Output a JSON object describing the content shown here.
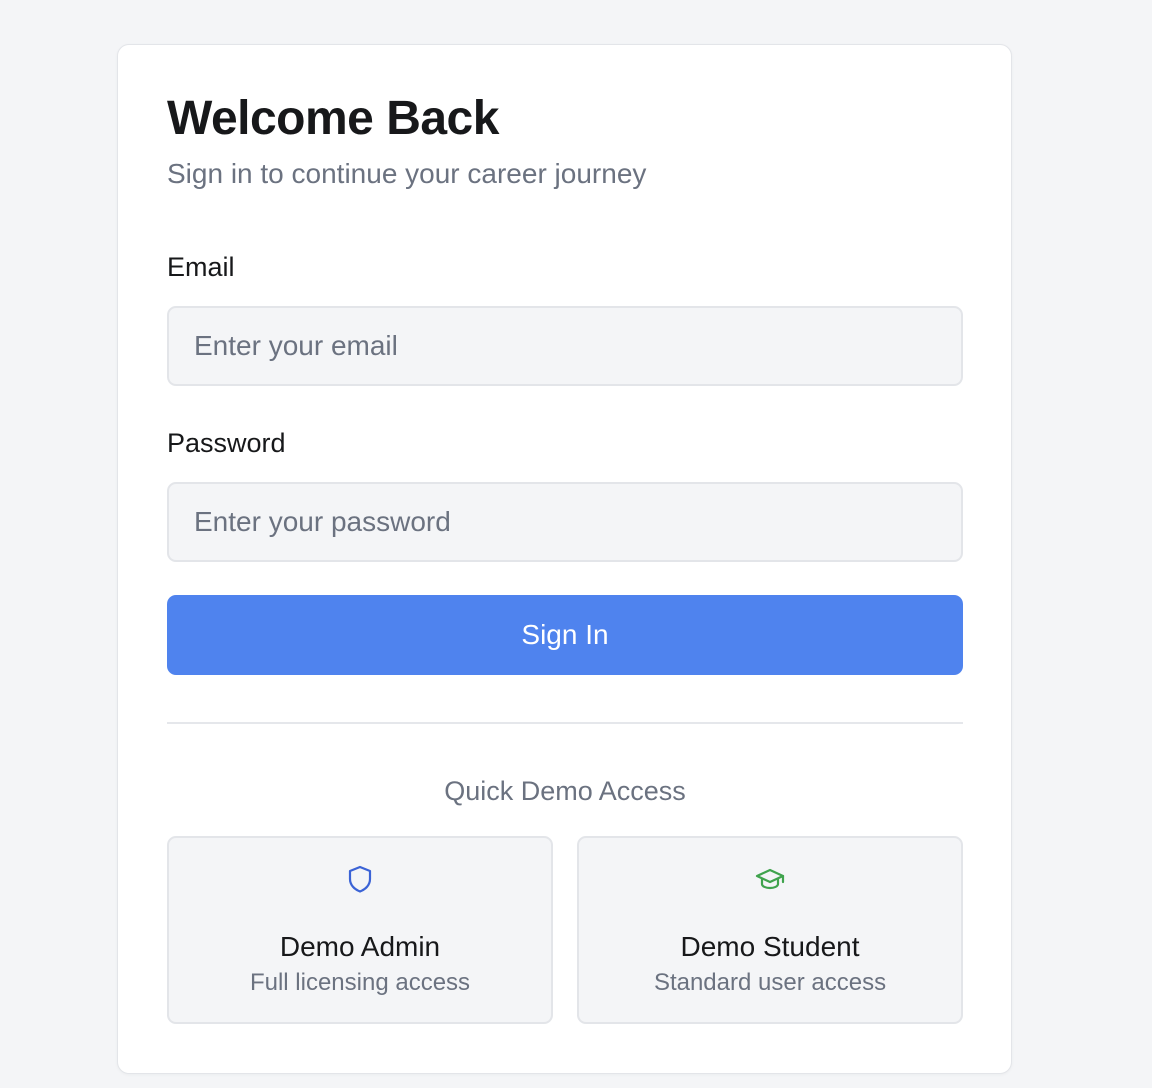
{
  "header": {
    "title": "Welcome Back",
    "subtitle": "Sign in to continue your career journey"
  },
  "form": {
    "email_label": "Email",
    "email_placeholder": "Enter your email",
    "email_value": "",
    "password_label": "Password",
    "password_placeholder": "Enter your password",
    "password_value": "",
    "submit_label": "Sign In"
  },
  "demo": {
    "heading": "Quick Demo Access",
    "accounts": [
      {
        "name": "Demo Admin",
        "description": "Full licensing access",
        "icon": "shield-icon",
        "color": "#3b63d6"
      },
      {
        "name": "Demo Student",
        "description": "Standard user access",
        "icon": "graduation-cap-icon",
        "color": "#3fa34d"
      }
    ]
  },
  "colors": {
    "background": "#f4f5f7",
    "card": "#ffffff",
    "primary": "#4f83ee",
    "text": "#17181a",
    "muted": "#6b7280",
    "border": "#e3e5e9"
  }
}
